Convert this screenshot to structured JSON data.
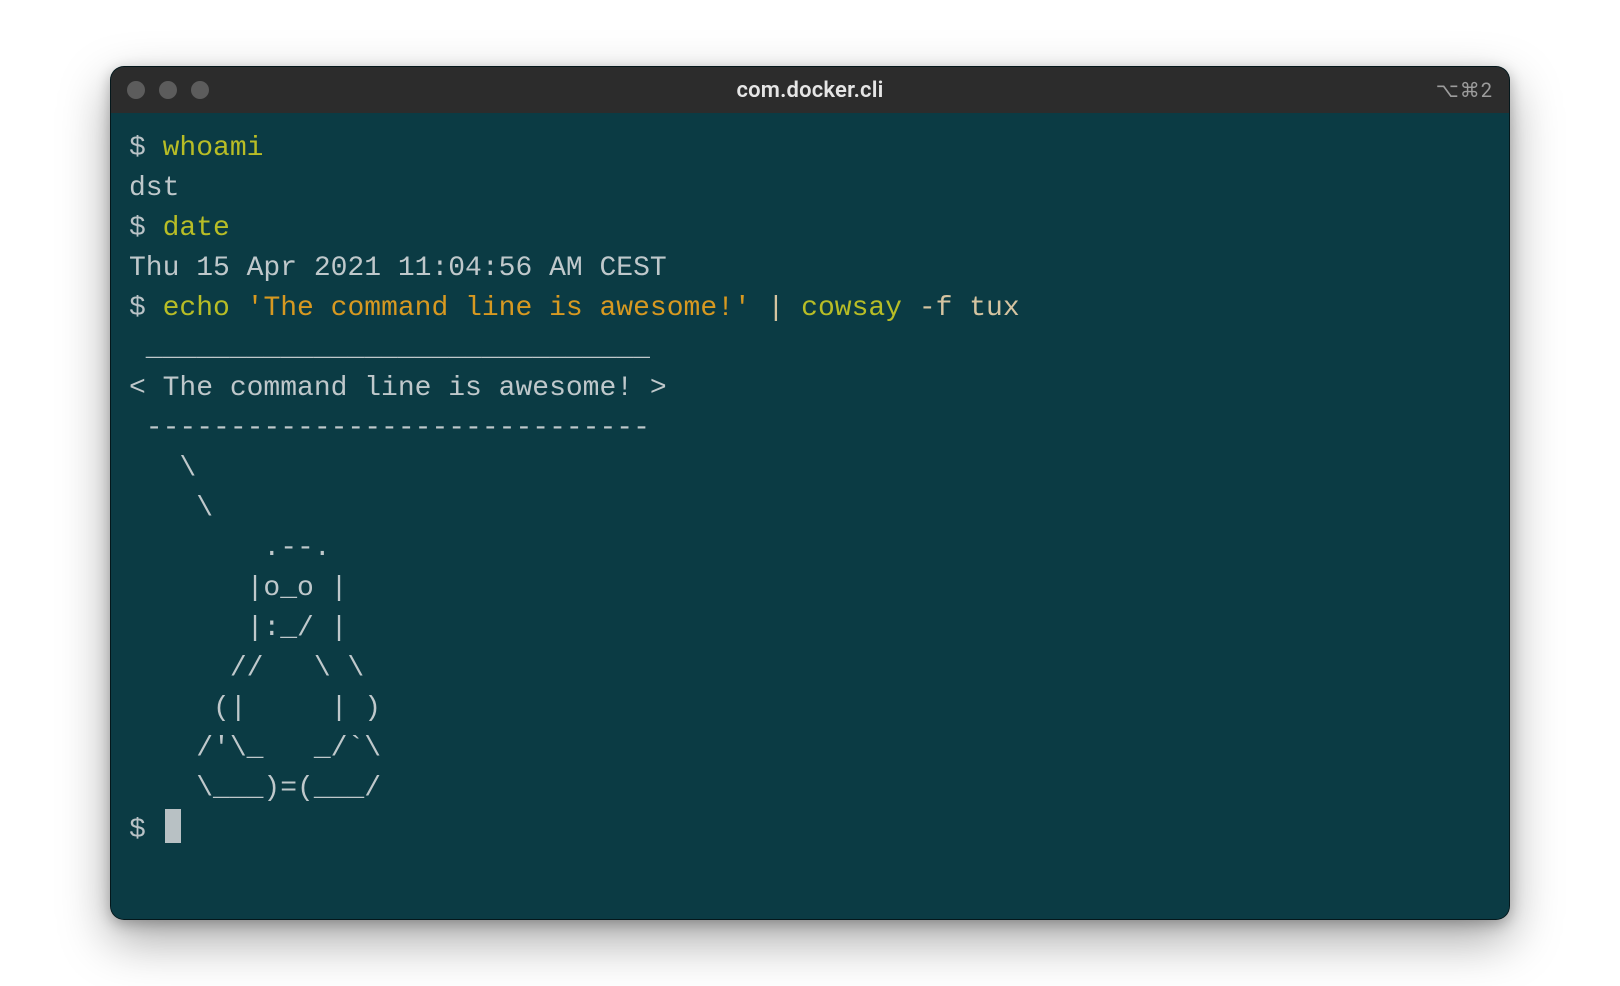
{
  "window": {
    "title": "com.docker.cli",
    "status_right": "⌥⌘2",
    "traffic_light_icons": [
      "close-icon",
      "minimize-icon",
      "zoom-icon"
    ]
  },
  "terminal": {
    "prompt": "$ ",
    "lines": [
      {
        "type": "command",
        "segments": [
          {
            "cls": "cmd",
            "text": "whoami"
          }
        ]
      },
      {
        "type": "output",
        "text": "dst"
      },
      {
        "type": "command",
        "segments": [
          {
            "cls": "cmd",
            "text": "date"
          }
        ]
      },
      {
        "type": "output",
        "text": "Thu 15 Apr 2021 11:04:56 AM CEST"
      },
      {
        "type": "command",
        "segments": [
          {
            "cls": "cmd",
            "text": "echo"
          },
          {
            "cls": "out",
            "text": " "
          },
          {
            "cls": "str",
            "text": "'The command line is awesome!'"
          },
          {
            "cls": "out",
            "text": " "
          },
          {
            "cls": "pipe",
            "text": "|"
          },
          {
            "cls": "out",
            "text": " "
          },
          {
            "cls": "cmd",
            "text": "cowsay"
          },
          {
            "cls": "out",
            "text": " "
          },
          {
            "cls": "flag",
            "text": "-f tux"
          }
        ]
      },
      {
        "type": "output",
        "text": " ______________________________"
      },
      {
        "type": "output",
        "text": "< The command line is awesome! >"
      },
      {
        "type": "output",
        "text": " ------------------------------"
      },
      {
        "type": "output",
        "text": "   \\"
      },
      {
        "type": "output",
        "text": "    \\"
      },
      {
        "type": "output",
        "text": "        .--."
      },
      {
        "type": "output",
        "text": "       |o_o |"
      },
      {
        "type": "output",
        "text": "       |:_/ |"
      },
      {
        "type": "output",
        "text": "      //   \\ \\"
      },
      {
        "type": "output",
        "text": "     (|     | )"
      },
      {
        "type": "output",
        "text": "    /'\\_   _/`\\"
      },
      {
        "type": "output",
        "text": "    \\___)=(___/"
      },
      {
        "type": "output",
        "text": ""
      },
      {
        "type": "prompt-cursor"
      }
    ]
  }
}
